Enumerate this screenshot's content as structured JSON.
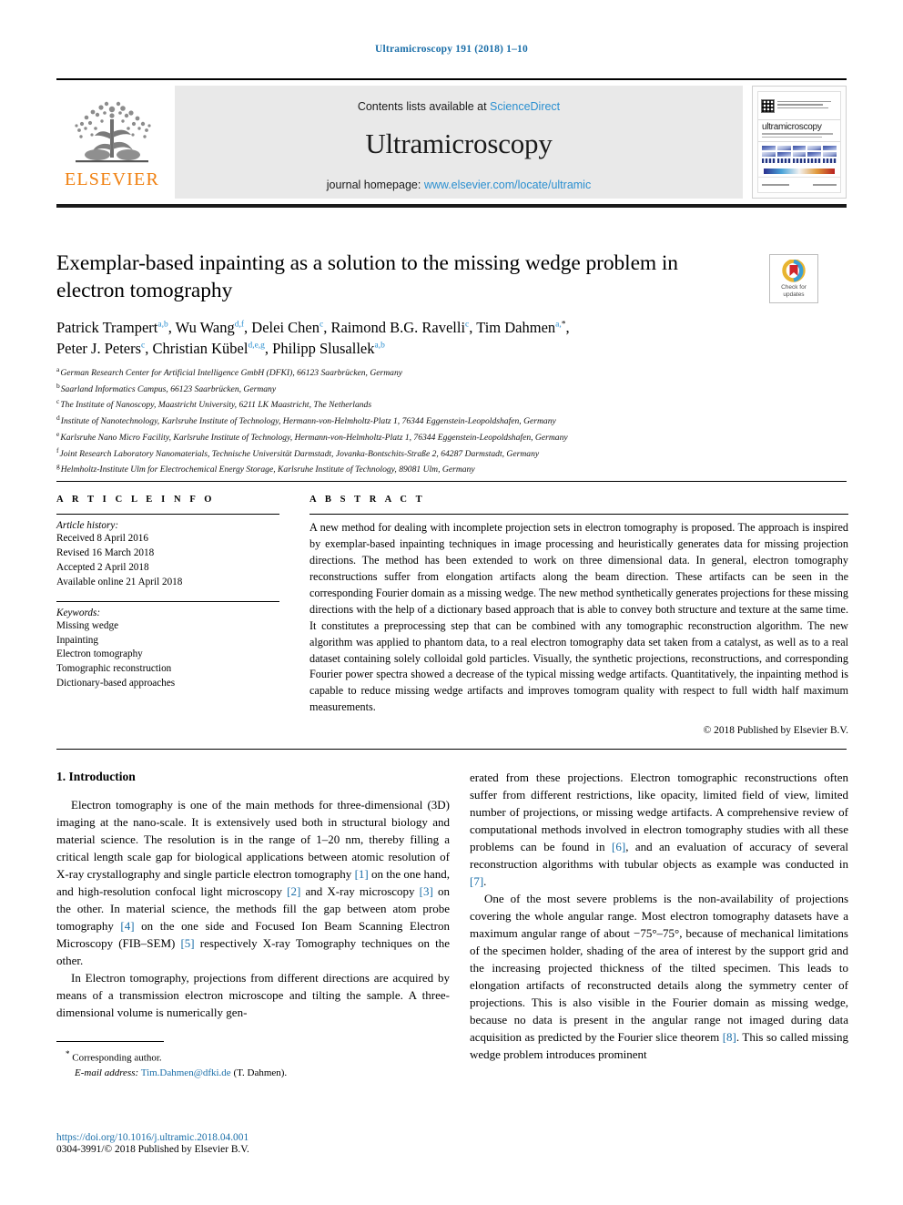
{
  "running_head": "Ultramicroscopy 191 (2018) 1–10",
  "banner": {
    "contents_prefix": "Contents lists available at ",
    "sciencedirect": "ScienceDirect",
    "journal_title": "Ultramicroscopy",
    "homepage_prefix": "journal homepage: ",
    "homepage_url": "www.elsevier.com/locate/ultramic",
    "publisher": "ELSEVIER",
    "cover_title": "ultramicroscopy",
    "accent_blue": "#2a8fd0",
    "elsevier_orange": "#f08010"
  },
  "crossmark": {
    "line1": "Check for",
    "line2": "updates"
  },
  "title": "Exemplar-based inpainting as a solution to the missing wedge problem in electron tomography",
  "authors_line1_html": "Patrick Trampert<sup>a,b</sup>, Wu Wang<sup>d,f</sup>, Delei Chen<sup>c</sup>, Raimond B.G. Ravelli<sup>c</sup>, Tim Dahmen<sup>a,<span class=\"star\">*</span></sup>,",
  "authors_line2_html": "Peter J. Peters<sup>c</sup>, Christian Kübel<sup>d,e,g</sup>, Philipp Slusallek<sup>a,b</sup>",
  "affiliations": [
    {
      "mark": "a",
      "text": "German Research Center for Artificial Intelligence GmbH (DFKI), 66123 Saarbrücken, Germany"
    },
    {
      "mark": "b",
      "text": "Saarland Informatics Campus, 66123 Saarbrücken, Germany"
    },
    {
      "mark": "c",
      "text": "The Institute of Nanoscopy, Maastricht University, 6211 LK Maastricht, The Netherlands"
    },
    {
      "mark": "d",
      "text": "Institute of Nanotechnology, Karlsruhe Institute of Technology, Hermann-von-Helmholtz-Platz 1, 76344 Eggenstein-Leopoldshafen, Germany"
    },
    {
      "mark": "e",
      "text": "Karlsruhe Nano Micro Facility, Karlsruhe Institute of Technology, Hermann-von-Helmholtz-Platz 1, 76344 Eggenstein-Leopoldshafen, Germany"
    },
    {
      "mark": "f",
      "text": "Joint Research Laboratory Nanomaterials, Technische Universität Darmstadt, Jovanka-Bontschits-Straße 2, 64287 Darmstadt, Germany"
    },
    {
      "mark": "g",
      "text": "Helmholtz-Institute Ulm for Electrochemical Energy Storage, Karlsruhe Institute of Technology, 89081 Ulm, Germany"
    }
  ],
  "article_info": {
    "heading": "A R T I C L E   I N F O",
    "history_label": "Article history:",
    "history": [
      "Received 8 April 2016",
      "Revised 16 March 2018",
      "Accepted 2 April 2018",
      "Available online 21 April 2018"
    ],
    "keywords_label": "Keywords:",
    "keywords": [
      "Missing wedge",
      "Inpainting",
      "Electron tomography",
      "Tomographic reconstruction",
      "Dictionary-based approaches"
    ]
  },
  "abstract": {
    "heading": "A B S T R A C T",
    "text": "A new method for dealing with incomplete projection sets in electron tomography is proposed. The approach is inspired by exemplar-based inpainting techniques in image processing and heuristically generates data for missing projection directions. The method has been extended to work on three dimensional data. In general, electron tomography reconstructions suffer from elongation artifacts along the beam direction. These artifacts can be seen in the corresponding Fourier domain as a missing wedge. The new method synthetically generates projections for these missing directions with the help of a dictionary based approach that is able to convey both structure and texture at the same time. It constitutes a preprocessing step that can be combined with any tomographic reconstruction algorithm. The new algorithm was applied to phantom data, to a real electron tomography data set taken from a catalyst, as well as to a real dataset containing solely colloidal gold particles. Visually, the synthetic projections, reconstructions, and corresponding Fourier power spectra showed a decrease of the typical missing wedge artifacts. Quantitatively, the inpainting method is capable to reduce missing wedge artifacts and improves tomogram quality with respect to full width half maximum measurements.",
    "copyright": "© 2018 Published by Elsevier B.V."
  },
  "body": {
    "section_number_title": "1. Introduction",
    "left_para_1_html": "Electron tomography is one of the main methods for three-dimensional (3D) imaging at the nano-scale. It is extensively used both in structural biology and material science. The resolution is in the range of 1&ndash;20 nm, thereby filling a critical length scale gap for biological applications between atomic resolution of X-ray crystallography and single particle electron tomography <span class=\"ref\">[1]</span> on the one hand, and high-resolution confocal light microscopy <span class=\"ref\">[2]</span> and X-ray microscopy <span class=\"ref\">[3]</span> on the other. In material science, the methods fill the gap between atom probe tomography <span class=\"ref\">[4]</span> on the one side and Focused Ion Beam Scanning Electron Microscopy (FIB&ndash;SEM) <span class=\"ref\">[5]</span> respectively X-ray Tomography techniques on the other.",
    "left_para_2_html": "In Electron tomography, projections from different directions are acquired by means of a transmission electron microscope and tilting the sample. A three-dimensional volume is numerically gen-",
    "right_para_1_html": "erated from these projections. Electron tomographic reconstructions often suffer from different restrictions, like opacity, limited field of view, limited number of projections, or missing wedge artifacts. A comprehensive review of computational methods involved in electron tomography studies with all these problems can be found in <span class=\"ref\">[6]</span>, and an evaluation of accuracy of several reconstruction algorithms with tubular objects as example was conducted in <span class=\"ref\">[7]</span>.",
    "right_para_2_html": "One of the most severe problems is the non-availability of projections covering the whole angular range. Most electron tomography datasets have a maximum angular range of about &minus;75&deg;&ndash;75&deg;, because of mechanical limitations of the specimen holder, shading of the area of interest by the support grid and the increasing projected thickness of the tilted specimen. This leads to elongation artifacts of reconstructed details along the symmetry center of projections. This is also visible in the Fourier domain as missing wedge, because no data is present in the angular range not imaged during data acquisition as predicted by the Fourier slice theorem <span class=\"ref\">[8]</span>. This so called missing wedge problem introduces prominent"
  },
  "footnote": {
    "corresponding_author": "Corresponding author.",
    "email_label": "E-mail address:",
    "email": "Tim.Dahmen@dfki.de",
    "email_suffix": "(T. Dahmen)."
  },
  "footer": {
    "doi": "https://doi.org/10.1016/j.ultramic.2018.04.001",
    "issn_line": "0304-3991/© 2018 Published by Elsevier B.V."
  }
}
